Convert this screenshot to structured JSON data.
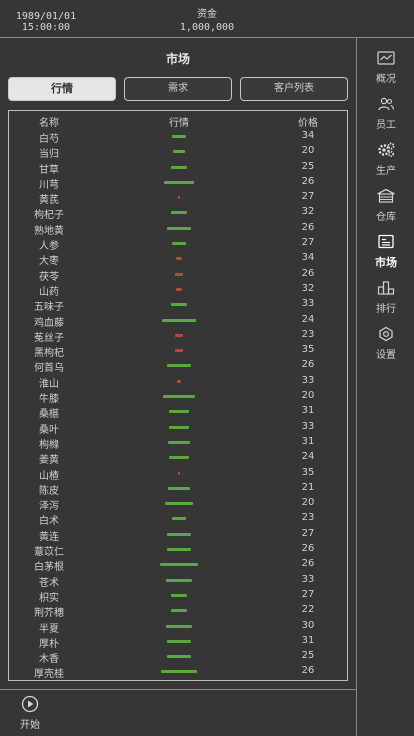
{
  "header": {
    "date": "1989/01/01",
    "time": "15:00:00",
    "funds_label": "资金",
    "funds_value": "1,000,000"
  },
  "page_title": "市场",
  "tabs": [
    {
      "label": "行情",
      "active": true
    },
    {
      "label": "需求",
      "active": false
    },
    {
      "label": "客户列表",
      "active": false
    }
  ],
  "table": {
    "columns": [
      "名称",
      "行情",
      "价格"
    ],
    "rows": [
      {
        "name": "白芍",
        "trend": 0.35,
        "price": "34"
      },
      {
        "name": "当归",
        "trend": 0.3,
        "price": "20"
      },
      {
        "name": "甘草",
        "trend": 0.38,
        "price": "25"
      },
      {
        "name": "川芎",
        "trend": 0.75,
        "price": "26"
      },
      {
        "name": "黄芪",
        "trend": -0.04,
        "price": "27"
      },
      {
        "name": "枸杞子",
        "trend": 0.38,
        "price": "32"
      },
      {
        "name": "熟地黄",
        "trend": 0.6,
        "price": "26"
      },
      {
        "name": "人参",
        "trend": 0.36,
        "price": "27"
      },
      {
        "name": "大枣",
        "trend": -0.14,
        "price": "34"
      },
      {
        "name": "茯苓",
        "trend": -0.2,
        "price": "26"
      },
      {
        "name": "山药",
        "trend": -0.14,
        "price": "32"
      },
      {
        "name": "五味子",
        "trend": 0.38,
        "price": "33"
      },
      {
        "name": "鸡血藤",
        "trend": 0.85,
        "price": "24"
      },
      {
        "name": "菟丝子",
        "trend": -0.2,
        "price": "23"
      },
      {
        "name": "黑枸杞",
        "trend": -0.2,
        "price": "35"
      },
      {
        "name": "何首乌",
        "trend": 0.62,
        "price": "26"
      },
      {
        "name": "淮山",
        "trend": -0.1,
        "price": "33"
      },
      {
        "name": "牛膝",
        "trend": 0.82,
        "price": "20"
      },
      {
        "name": "桑椹",
        "trend": 0.5,
        "price": "31"
      },
      {
        "name": "桑叶",
        "trend": 0.48,
        "price": "33"
      },
      {
        "name": "枸橼",
        "trend": 0.55,
        "price": "31"
      },
      {
        "name": "姜黄",
        "trend": 0.5,
        "price": "24"
      },
      {
        "name": "山楂",
        "trend": -0.02,
        "price": "35"
      },
      {
        "name": "陈皮",
        "trend": 0.55,
        "price": "21"
      },
      {
        "name": "泽泻",
        "trend": 0.72,
        "price": "20"
      },
      {
        "name": "白术",
        "trend": 0.35,
        "price": "23"
      },
      {
        "name": "黄连",
        "trend": 0.62,
        "price": "27"
      },
      {
        "name": "薏苡仁",
        "trend": 0.58,
        "price": "26"
      },
      {
        "name": "白茅根",
        "trend": 0.95,
        "price": "26"
      },
      {
        "name": "苍术",
        "trend": 0.65,
        "price": "33"
      },
      {
        "name": "枳实",
        "trend": 0.42,
        "price": "27"
      },
      {
        "name": "荆芥穗",
        "trend": 0.4,
        "price": "22"
      },
      {
        "name": "半夏",
        "trend": 0.65,
        "price": "30"
      },
      {
        "name": "厚朴",
        "trend": 0.6,
        "price": "31"
      },
      {
        "name": "木香",
        "trend": 0.6,
        "price": "25"
      },
      {
        "name": "厚壳桂",
        "trend": 0.88,
        "price": "26"
      }
    ]
  },
  "sidebar": {
    "items": [
      {
        "label": "概况",
        "icon": "chart-icon",
        "active": false
      },
      {
        "label": "员工",
        "icon": "people-icon",
        "active": false
      },
      {
        "label": "生产",
        "icon": "gears-icon",
        "active": false
      },
      {
        "label": "仓库",
        "icon": "warehouse-icon",
        "active": false
      },
      {
        "label": "市场",
        "icon": "market-icon",
        "active": true
      },
      {
        "label": "排行",
        "icon": "ranking-icon",
        "active": false
      },
      {
        "label": "设置",
        "icon": "settings-icon",
        "active": false
      }
    ]
  },
  "start": {
    "label": "开始",
    "icon": "play-icon"
  },
  "colors": {
    "up": "#5aa840",
    "down": "#b94a3a"
  }
}
